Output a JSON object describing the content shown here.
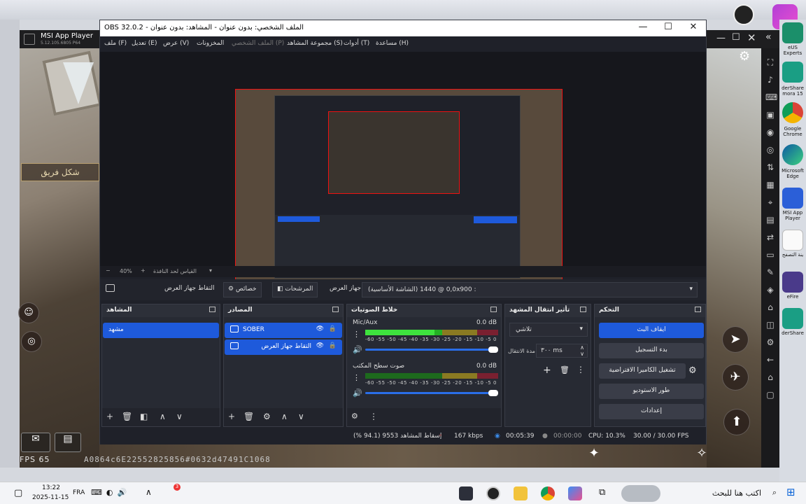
{
  "msi": {
    "title": "MSI App Player",
    "version": "5.12.105.6805 P64",
    "team_label": "شكل فريق",
    "fps": "FPS 65",
    "hash": "A0864c6E22552825856#0632d47491C1068"
  },
  "obs": {
    "window_title": "OBS 32.0.2 - الملف الشخصي: بدون عنوان - المشاهد: بدون عنوان",
    "menu": [
      "ملف (F)",
      "تعديل (E)",
      "عرض (V)",
      "المخزونات",
      "الملف الشخصي (P)",
      "مجموعة المشاهد (S)",
      "أدوات (T)",
      "مساعدة (H)"
    ],
    "zoom": {
      "value": "40%",
      "label": "القياس لحد النافذة"
    },
    "source_bar": {
      "device_label": "جهاز العرض",
      "device_value": "(الشاشة الأساسية) 0,0 @ 1440x900 :",
      "filters": "المرشحات",
      "properties": "خصائص",
      "capture": "التقاط جهاز العرض"
    },
    "scenes": {
      "title": "المشاهد",
      "items": [
        "مشهد"
      ]
    },
    "sources": {
      "title": "المصادر",
      "items": [
        "SOBER",
        "التقاط جهاز العرض"
      ]
    },
    "mixer": {
      "title": "خلاط الصوتيات",
      "channels": [
        {
          "name": "Mic/Aux",
          "db": "0.0 dB",
          "level": 0.52
        },
        {
          "name": "صوت سطح المكتب",
          "db": "0.0 dB",
          "level": 0.0
        }
      ],
      "scale": "-60 -55 -50 -45 -40 -35 -30 -25 -20 -15 -10 -5 0"
    },
    "transitions": {
      "title": "تأثير انتقال المشهد",
      "type": "تلاشي",
      "duration_label": "مدة الانتقال",
      "duration_value": "٣٠٠ ms"
    },
    "controls": {
      "title": "التحكم",
      "stop_stream": "ايقاف البث",
      "start_record": "بدء التسجيل",
      "virtual_cam": "تشغيل الكاميرا الافتراضية",
      "studio_mode": "طور الاستوديو",
      "settings": "إعدادات"
    },
    "status": {
      "dropped": "إسقاط المشاهد 9553 (94.1 %)",
      "bitrate": "167 kbps",
      "live_time": "00:05:39",
      "rec_time": "00:00:00",
      "cpu": "CPU: 10.3%",
      "fps": "30.00 / 30.00 FPS"
    }
  },
  "desktop": {
    "labels": [
      "eUS Experts",
      "derShare mora 15",
      "Google Chrome",
      "Microsoft Edge",
      "MSI App Player",
      "ينة التصفح",
      "eFire",
      "derShare"
    ]
  },
  "taskbar": {
    "search": "اكتب هنا للبحث",
    "time": "13:22",
    "date": "2025-11-15",
    "lang": "FRA"
  },
  "colors": {
    "accent": "#1e5adb",
    "border_red": "#e11"
  }
}
